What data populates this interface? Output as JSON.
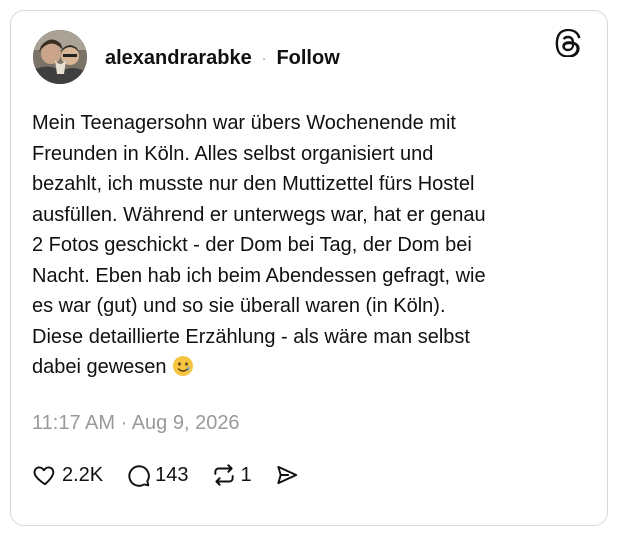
{
  "post": {
    "username": "alexandrarabke",
    "separator": "·",
    "follow_label": "Follow",
    "text": "Mein Teenagersohn war übers Wochenende mit\nFreunden in Köln. Alles selbst organisiert und\nbezahlt, ich musste nur den Muttizettel fürs Hostel\nausfüllen. Während er unterwegs war, hat er genau\n2 Fotos geschickt - der Dom bei Tag, der Dom bei\nNacht. Eben hab ich beim Abendessen gefragt, wie\nes war (gut) und so sie überall waren (in Köln).\nDiese detaillierte Erzählung - als wäre man selbst\ndabei gewesen",
    "emoji": "smiling-face-with-tear",
    "timestamp": "11:17 AM · Aug 9, 2026"
  },
  "actions": {
    "likes": "2.2K",
    "replies": "143",
    "reposts": "1"
  },
  "icons": {
    "brand": "threads-logo-icon",
    "like": "heart-icon",
    "reply": "comment-icon",
    "repost": "repost-icon",
    "share": "send-icon"
  },
  "colors": {
    "text": "#111111",
    "muted": "#9a9a9a",
    "border": "#d9d9d9",
    "emoji": "#f5c542"
  }
}
